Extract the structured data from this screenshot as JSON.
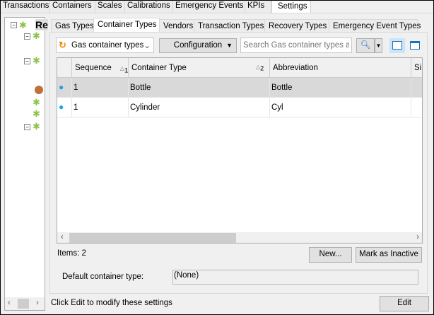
{
  "top_tabs": [
    "Transactions",
    "Containers",
    "Scales",
    "Calibrations",
    "Emergency Events",
    "KPIs",
    "Settings"
  ],
  "tree": {
    "root_label": "Re"
  },
  "inner_tabs": [
    "Gas Types",
    "Container Types",
    "Vendors",
    "Transaction Types",
    "Recovery Types",
    "Emergency Event Types"
  ],
  "toolbar": {
    "view_select": "Gas container types",
    "configuration": "Configuration",
    "search_placeholder": "Search Gas container types at y"
  },
  "grid": {
    "columns": [
      {
        "label": "Sequence",
        "sort": "1"
      },
      {
        "label": "Container Type",
        "sort": "2"
      },
      {
        "label": "Abbreviation",
        "sort": ""
      },
      {
        "label": "Si",
        "sort": ""
      }
    ],
    "rows": [
      {
        "sequence": "1",
        "type": "Bottle",
        "abbr": "Bottle"
      },
      {
        "sequence": "1",
        "type": "Cylinder",
        "abbr": "Cyl"
      }
    ]
  },
  "items_count": "Items: 2",
  "new_button": "New...",
  "inactive_button": "Mark as Inactive",
  "default_label": "Default container type:",
  "default_value": "(None)",
  "status_text": "Click Edit to modify these settings",
  "edit_button": "Edit"
}
